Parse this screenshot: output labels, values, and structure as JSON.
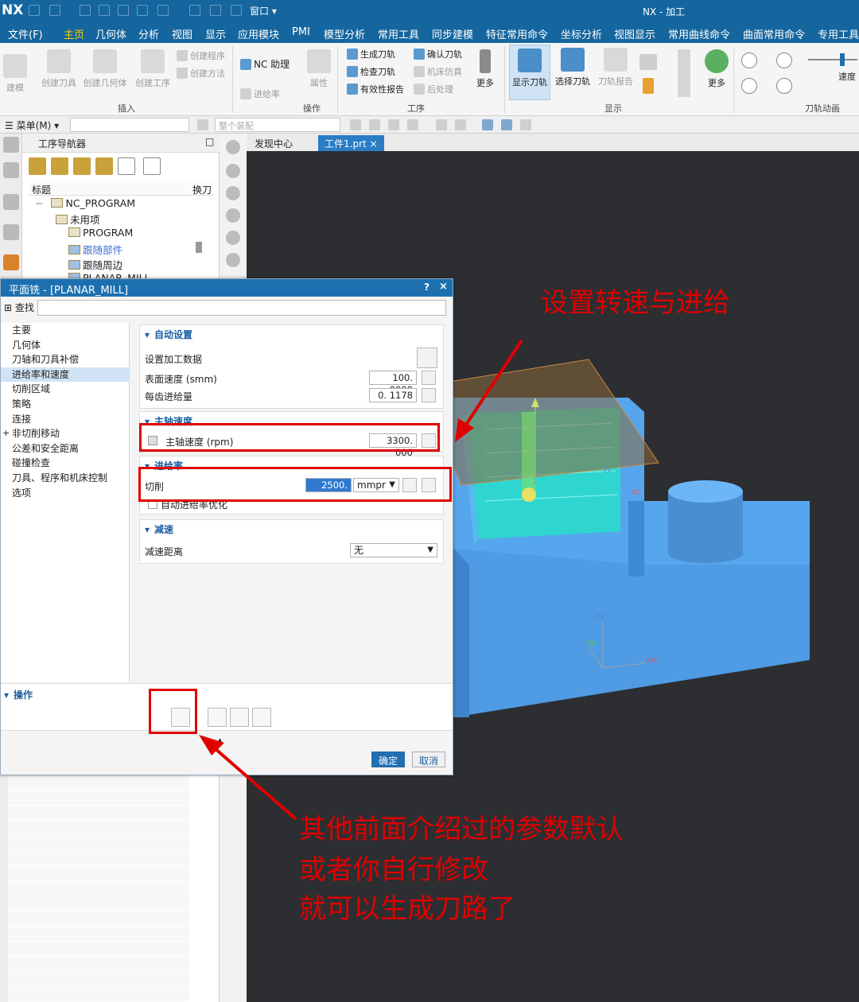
{
  "app": {
    "logo": "NX",
    "window_menu": "窗口",
    "window_title": "NX - 加工"
  },
  "menubar": [
    "文件(F)",
    "主页",
    "几何体",
    "分析",
    "视图",
    "显示",
    "应用模块",
    "PMI",
    "模型分析",
    "常用工具",
    "同步建模",
    "特征常用命令",
    "坐标分析",
    "视图显示",
    "常用曲线命令",
    "曲面常用命令",
    "专用工具"
  ],
  "ribbon": {
    "insert": {
      "big": [
        "建模",
        "创建刀具",
        "创建几何体",
        "创建工序"
      ],
      "small": [
        "创建程序",
        "创建方法"
      ],
      "group": "插入"
    },
    "nc_helper": "NC 助理",
    "feedrate_small": "进给率",
    "attribute": "属性",
    "operate_group": "操作",
    "operation": {
      "small": [
        "生成刀轨",
        "检查刀轨",
        "有效性报告",
        "确认刀轨",
        "机床仿真",
        "后处理"
      ],
      "more": "更多",
      "group": "工序"
    },
    "display": {
      "big": [
        "显示刀轨",
        "选择刀轨",
        "刀轨报告"
      ],
      "more": "更多",
      "group": "显示"
    },
    "animation": {
      "speed": "速度",
      "group": "刀轨动画"
    }
  },
  "cmdbar": {
    "menu": "菜单(M)",
    "assembly": "整个装配"
  },
  "navigator": {
    "title": "工序导航器",
    "col_title": "标题",
    "col_tool": "换刀",
    "tree": [
      "NC_PROGRAM",
      "未用项",
      "PROGRAM",
      "跟随部件",
      "跟随周边",
      "PLANAR_MILL"
    ]
  },
  "tabs": [
    "发现中心",
    "工件1.prt"
  ],
  "dialog": {
    "title": "平面铣 - [PLANAR_MILL]",
    "help": "?",
    "close": "×",
    "find_label": "查找",
    "left_items": [
      "主要",
      "几何体",
      "刀轴和刀具补偿",
      "进给率和速度",
      "切削区域",
      "策略",
      "连接",
      "非切削移动",
      "公差和安全距离",
      "碰撞检查",
      "刀具、程序和机床控制",
      "选项"
    ],
    "selected_item": "进给率和速度",
    "auto": {
      "header": "自动设置",
      "set_data": "设置加工数据",
      "surface_speed_label": "表面速度 (smm)",
      "surface_speed": "100. 0000",
      "feed_per_tooth_label": "每齿进给量",
      "feed_per_tooth": "0. 1178"
    },
    "spindle": {
      "header": "主轴速度",
      "label": "主轴速度 (rpm)",
      "value": "3300. 000"
    },
    "feed": {
      "header": "进给率",
      "cut_label": "切削",
      "cut_value": "2500. 000",
      "unit": "mmpr",
      "auto_opt": "自动进给率优化"
    },
    "decel": {
      "header": "减速",
      "label": "减速距离",
      "value": "无"
    },
    "operations_header": "操作",
    "ok": "确定",
    "cancel": "取消"
  },
  "viewport": {
    "axes": [
      "ZC",
      "XC",
      "ZM",
      "YM",
      "XM"
    ]
  },
  "annotations": {
    "top": "设置转速与进给",
    "bottom": [
      "其他前面介绍过的参数默认",
      "或者你自行修改",
      "就可以生成刀路了"
    ]
  },
  "colors": {
    "nx_blue": "#15669e",
    "annotation_red": "#e00000",
    "part_blue": "#5aa8f0",
    "path_cyan": "#33e0d8"
  }
}
